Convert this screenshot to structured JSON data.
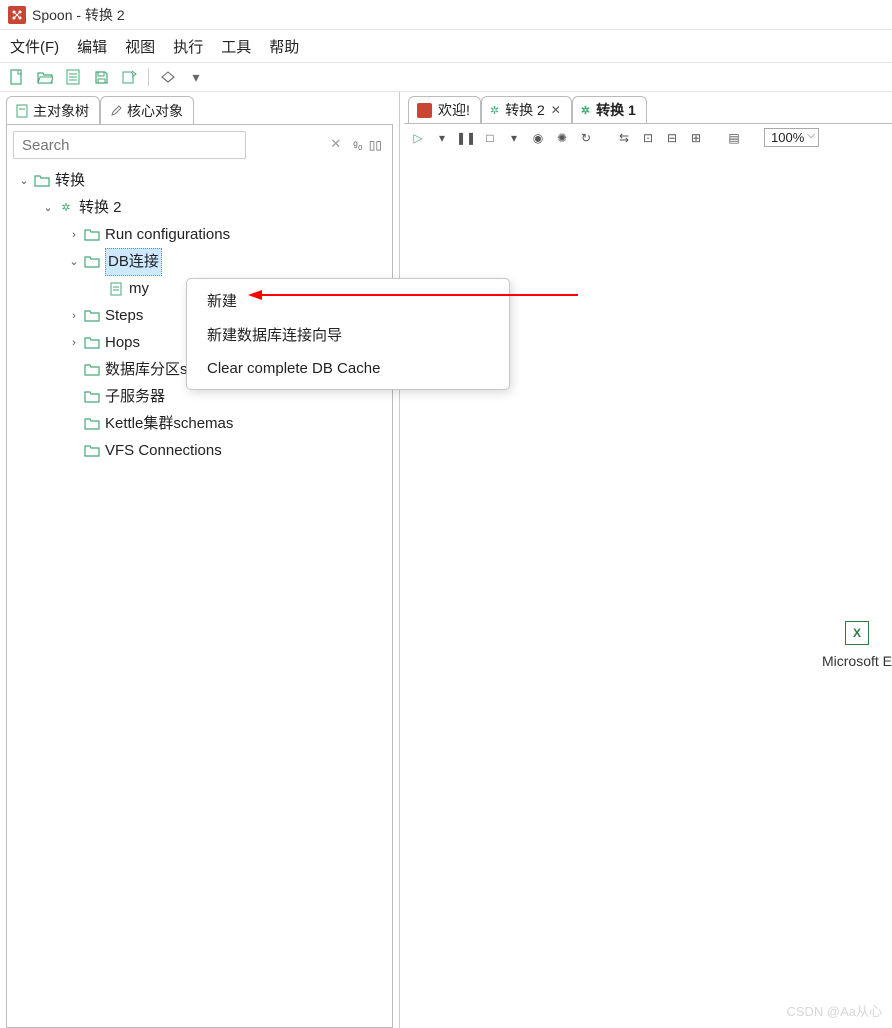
{
  "window": {
    "title": "Spoon - 转换 2"
  },
  "menu": {
    "file": "文件(F)",
    "edit": "编辑",
    "view": "视图",
    "run": "执行",
    "tools": "工具",
    "help": "帮助"
  },
  "panelTabs": {
    "mainTree": "主对象树",
    "coreObjects": "核心对象"
  },
  "search": {
    "placeholder": "Search"
  },
  "tree": {
    "root": "转换",
    "trans": "转换 2",
    "runConfig": "Run configurations",
    "dbConn": "DB连接",
    "dbItem": "my",
    "steps": "Steps",
    "hops": "Hops",
    "dbSchemas": "数据库分区schemas",
    "subServers": "子服务器",
    "kettleSchemas": "Kettle集群schemas",
    "vfs": "VFS Connections"
  },
  "docTabs": {
    "welcome": "欢迎!",
    "trans2": "转换 2",
    "trans1": "转换 1"
  },
  "zoom": "100%",
  "contextMenu": {
    "new": "新建",
    "newWizard": "新建数据库连接向导",
    "clearCache": "Clear complete DB Cache"
  },
  "excelLabel": "Microsoft E",
  "watermark": "CSDN @Aa从心"
}
